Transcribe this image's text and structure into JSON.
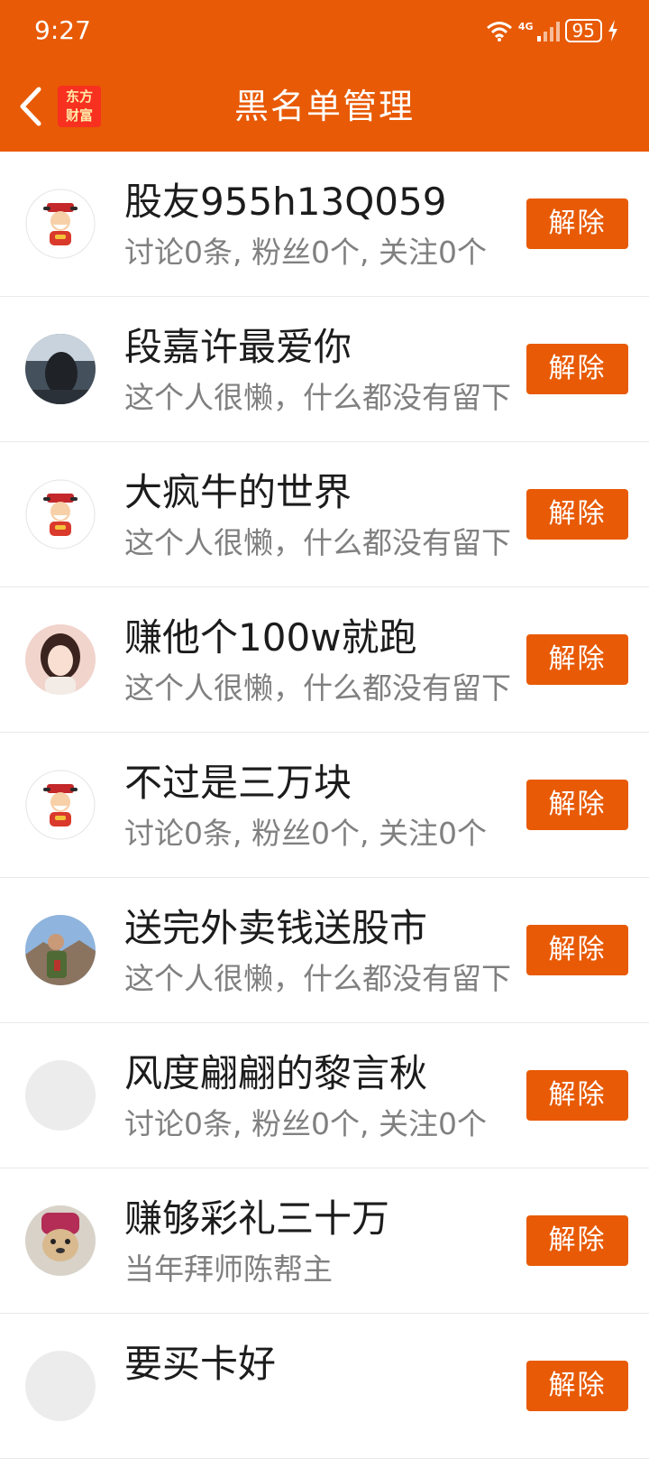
{
  "status_bar": {
    "time": "9:27",
    "network": "4G",
    "battery": "95"
  },
  "header": {
    "title": "黑名单管理",
    "logo_text_line1": "东方",
    "logo_text_line2": "财富"
  },
  "colors": {
    "accent": "#e85a05"
  },
  "remove_label": "解除",
  "items": [
    {
      "name": "股友955h13Q059",
      "desc": "讨论0条, 粉丝0个, 关注0个",
      "avatar": "fortune-god"
    },
    {
      "name": "段嘉许最爱你",
      "desc": "这个人很懒，什么都没有留下",
      "avatar": "dark-photo"
    },
    {
      "name": "大疯牛的世界",
      "desc": "这个人很懒，什么都没有留下",
      "avatar": "fortune-god"
    },
    {
      "name": "赚他个100w就跑",
      "desc": "这个人很懒，什么都没有留下",
      "avatar": "woman-photo"
    },
    {
      "name": "不过是三万块",
      "desc": "讨论0条, 粉丝0个, 关注0个",
      "avatar": "fortune-god"
    },
    {
      "name": "送完外卖钱送股市",
      "desc": "这个人很懒，什么都没有留下",
      "avatar": "man-photo"
    },
    {
      "name": "风度翩翩的黎言秋",
      "desc": "讨论0条, 粉丝0个, 关注0个",
      "avatar": "blank"
    },
    {
      "name": "赚够彩礼三十万",
      "desc": "当年拜师陈帮主",
      "avatar": "dog-photo"
    },
    {
      "name": "要买卡好",
      "desc": "",
      "avatar": "blank"
    }
  ]
}
